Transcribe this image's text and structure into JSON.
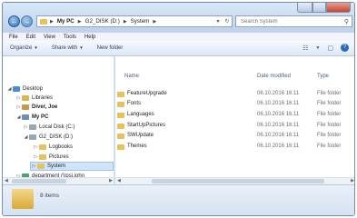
{
  "address": {
    "crumbs": [
      "My PC",
      "G2_DISK (D:)",
      "System"
    ]
  },
  "search": {
    "placeholder": "Search System"
  },
  "menu": [
    "File",
    "Edit",
    "View",
    "Tools",
    "Help"
  ],
  "toolbar": {
    "organize_label": "Organize",
    "share_label": "Share with",
    "new_folder_label": "New folder"
  },
  "nav_tree": [
    {
      "label": "Desktop",
      "icon": "desktop-icon",
      "expanded": true
    },
    {
      "label": "Libraries",
      "icon": "libraries-icon"
    },
    {
      "label": "Diver, Joe",
      "icon": "user-icon"
    },
    {
      "label": "My PC",
      "icon": "computer-icon",
      "expanded": true
    },
    {
      "label": "Local Disk (C:)",
      "icon": "drive-icon"
    },
    {
      "label": "G2_DISK (D:)",
      "icon": "drive-icon",
      "expanded": true
    },
    {
      "label": "Logbooks",
      "icon": "folder-icon"
    },
    {
      "label": "Pictures",
      "icon": "folder-icon"
    },
    {
      "label": "System",
      "icon": "folder-icon",
      "selected": true
    },
    {
      "label": "department (\\\\psi.john",
      "icon": "network-drive-icon"
    }
  ],
  "columns": {
    "name": "Name",
    "date": "Date modified",
    "type": "Type"
  },
  "files": [
    {
      "name": "FeatureUpgrade",
      "date": "06.10.2016 16:11",
      "type": "File folder"
    },
    {
      "name": "Fonts",
      "date": "06.10.2016 16:11",
      "type": "File folder"
    },
    {
      "name": "Languages",
      "date": "06.10.2016 16:11",
      "type": "File folder"
    },
    {
      "name": "StartUpPictures",
      "date": "06.10.2016 16:11",
      "type": "File folder"
    },
    {
      "name": "SWUpdate",
      "date": "06.10.2016 16:11",
      "type": "File folder"
    },
    {
      "name": "Themes",
      "date": "06.10.2016 16:11",
      "type": "File folder"
    }
  ],
  "status": {
    "items_text": "8 items"
  },
  "colors": {
    "accent": "#2f6bb4",
    "folder": "#e8c15a",
    "selection": "#cfe4f8"
  }
}
